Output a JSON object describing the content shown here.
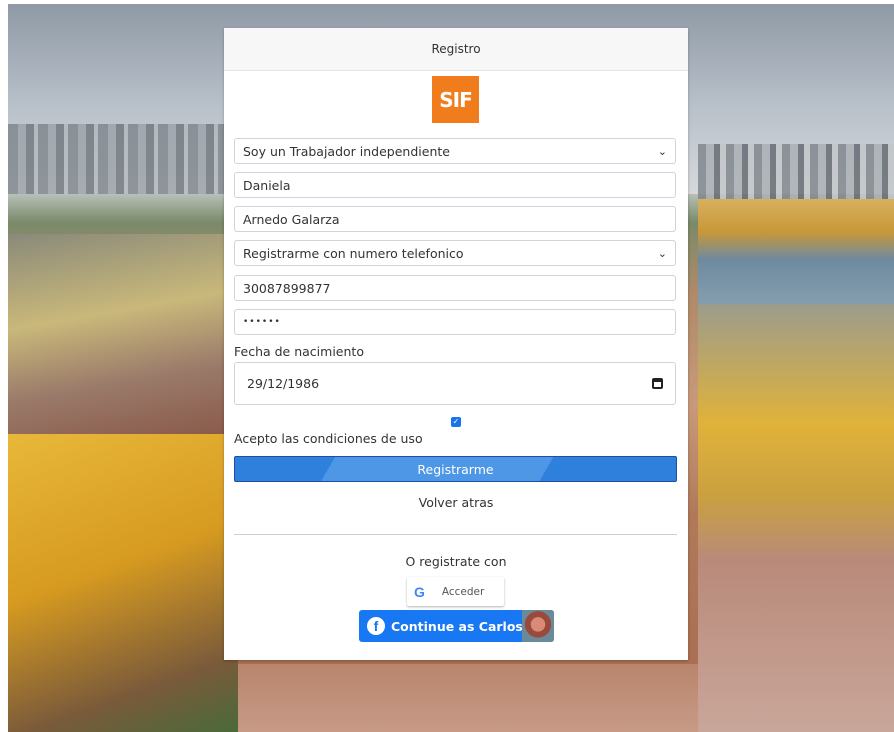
{
  "header": {
    "title": "Registro"
  },
  "logo": {
    "text": "SIF",
    "color": "#f07c1c"
  },
  "form": {
    "user_type": "Soy un Trabajador independiente",
    "first_name": "Daniela",
    "last_name": "Arnedo Galarza",
    "register_method": "Registrarme con numero telefonico",
    "phone": "30087899877",
    "password_mask": "••••••",
    "birth_label": "Fecha de nacimiento",
    "birth_date": "29/12/1986",
    "terms_checked": true,
    "terms_label": "Acepto las condiciones de uso",
    "submit_label": "Registrarme",
    "back_label": "Volver atras"
  },
  "social": {
    "or_label": "O registrate con",
    "google_label": "Acceder",
    "facebook_label": "Continue as Carlos"
  },
  "colors": {
    "primary": "#2f7fdc",
    "facebook": "#1877f2",
    "checkbox": "#1a73e8"
  }
}
